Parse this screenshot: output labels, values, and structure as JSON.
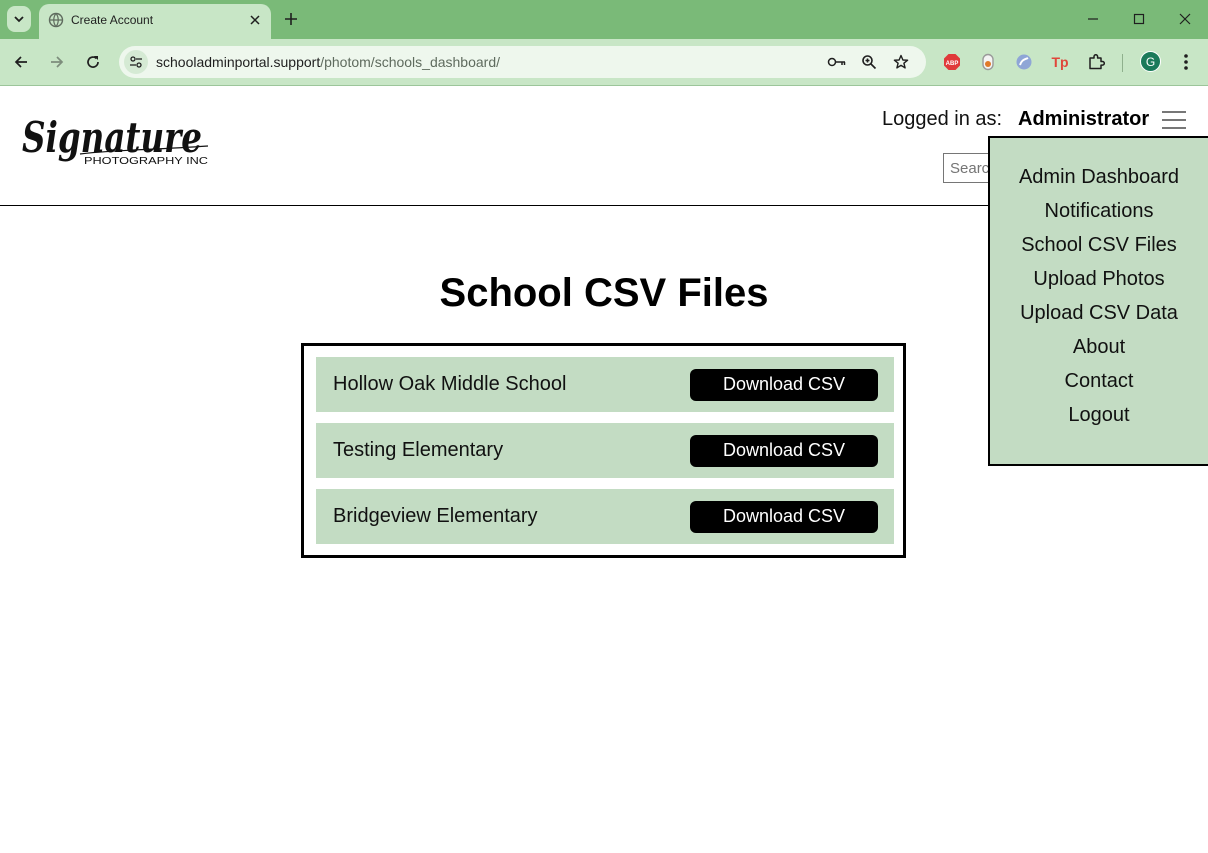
{
  "browser": {
    "tab_title": "Create Account",
    "url_host": "schooladminportal.support",
    "url_path": "/photom/schools_dashboard/",
    "profile_initial": "G",
    "extensions": [
      "adblock-icon",
      "extension-icon",
      "extension-icon",
      "tp-extension-icon",
      "puzzle-icon"
    ]
  },
  "header": {
    "logo_text": "Signature",
    "logo_subtext": "PHOTOGRAPHY INC",
    "logged_in_label": "Logged in as:",
    "logged_in_user": "Administrator",
    "search_placeholder": "Search"
  },
  "menu": {
    "items": [
      {
        "label": "Admin Dashboard"
      },
      {
        "label": "Notifications"
      },
      {
        "label": "School CSV Files"
      },
      {
        "label": "Upload Photos"
      },
      {
        "label": "Upload CSV Data"
      },
      {
        "label": "About"
      },
      {
        "label": "Contact"
      },
      {
        "label": "Logout"
      }
    ]
  },
  "main": {
    "title": "School CSV Files",
    "schools": [
      {
        "name": "Hollow Oak Middle School",
        "button": "Download CSV"
      },
      {
        "name": "Testing Elementary",
        "button": "Download CSV"
      },
      {
        "name": "Bridgeview Elementary",
        "button": "Download CSV"
      }
    ]
  },
  "colors": {
    "chrome_accent": "#7aba78",
    "chrome_surface": "#c8e6c6",
    "row_background": "#c3dcc3",
    "button_background": "#000000"
  }
}
